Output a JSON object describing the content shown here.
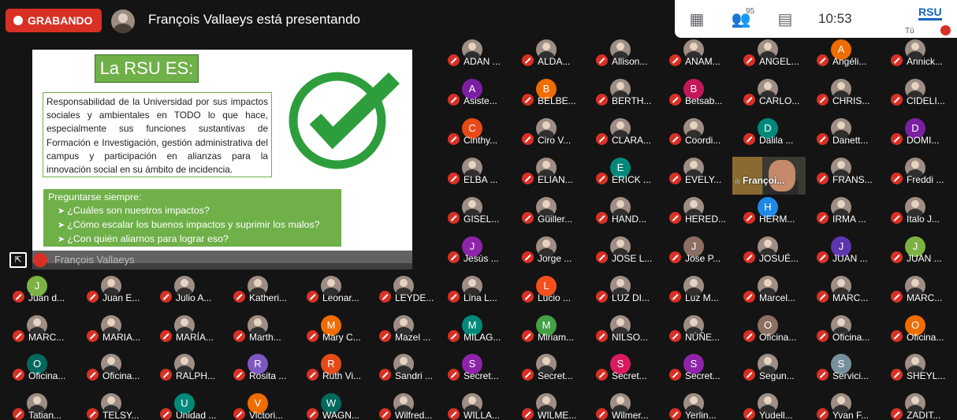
{
  "recording": {
    "label": "GRABANDO"
  },
  "presenter": {
    "text": "François Vallaeys está presentando",
    "name": "François Vallaeys"
  },
  "toolbar": {
    "participants_count": "95",
    "time": "10:53",
    "self_label": "Tú",
    "logo_text": "RSU"
  },
  "slide": {
    "title": "La RSU ES:",
    "body": "Responsabilidad de la Universidad por sus impactos sociales y ambientales en TODO lo que hace, especialmente sus funciones sustantivas de Formación e Investigación, gestión administrativa del campus y participación en alianzas para la innovación social en su ámbito de incidencia.",
    "q_title": "Preguntarse siempre:",
    "questions": [
      "¿Cuáles son nuestros impactos?",
      "¿Cómo escalar los buenos impactos y suprimir los malos?",
      "¿Con quién aliarnos para lograr eso?"
    ]
  },
  "active_video_label": "Françoi...",
  "colors": {
    "accent_red": "#d93025",
    "slide_green": "#6fb049"
  },
  "participants": [
    {
      "name": "ADAN ...",
      "av": "photo"
    },
    {
      "name": "ALDA...",
      "av": "photo"
    },
    {
      "name": "Allison...",
      "av": "photo"
    },
    {
      "name": "ANAM...",
      "av": "photo"
    },
    {
      "name": "ANGEL...",
      "av": "photo"
    },
    {
      "name": "Angéli...",
      "av": "A",
      "bg": "#ef6c00"
    },
    {
      "name": "Annick...",
      "av": "photo"
    },
    {
      "name": "Asiste...",
      "av": "A",
      "bg": "#7b1fa2"
    },
    {
      "name": "BELBE...",
      "av": "B",
      "bg": "#ef6c00"
    },
    {
      "name": "BERTH...",
      "av": "photo"
    },
    {
      "name": "Betsab...",
      "av": "B",
      "bg": "#c2185b"
    },
    {
      "name": "CARLO...",
      "av": "photo"
    },
    {
      "name": "CHRIS...",
      "av": "photo"
    },
    {
      "name": "CIDELI...",
      "av": "photo"
    },
    {
      "name": "Cinthy...",
      "av": "C",
      "bg": "#e64a19"
    },
    {
      "name": "Ciro V...",
      "av": "photo"
    },
    {
      "name": "CLARA...",
      "av": "photo"
    },
    {
      "name": "Coordi...",
      "av": "photo"
    },
    {
      "name": "Dalila ...",
      "av": "D",
      "bg": "#00897b"
    },
    {
      "name": "Danett...",
      "av": "photo"
    },
    {
      "name": "DOMI...",
      "av": "D",
      "bg": "#7b1fa2"
    },
    {
      "name": "ELBA ...",
      "av": "photo"
    },
    {
      "name": "ELIAN...",
      "av": "photo"
    },
    {
      "name": "ERICK ...",
      "av": "E",
      "bg": "#00897b"
    },
    {
      "name": "EVELY...",
      "av": "photo"
    },
    {
      "name": "FRANS...",
      "av": "photo"
    },
    {
      "name": "Freddi ...",
      "av": "photo"
    },
    {
      "name": "GISEL...",
      "av": "photo"
    },
    {
      "name": "Güiller...",
      "av": "photo"
    },
    {
      "name": "HAND...",
      "av": "photo"
    },
    {
      "name": "HERED...",
      "av": "photo"
    },
    {
      "name": "HERM...",
      "av": "H",
      "bg": "#1e88e5"
    },
    {
      "name": "IRMA ...",
      "av": "photo"
    },
    {
      "name": "Italo J...",
      "av": "photo"
    },
    {
      "name": "Jesús ...",
      "av": "J",
      "bg": "#8e24aa"
    },
    {
      "name": "Jorge ...",
      "av": "photo"
    },
    {
      "name": "JOSE L...",
      "av": "photo"
    },
    {
      "name": "Jose P...",
      "av": "J",
      "bg": "#8d6e63"
    },
    {
      "name": "JOSUÉ...",
      "av": "photo"
    },
    {
      "name": "JUAN ...",
      "av": "J",
      "bg": "#5e35b1"
    },
    {
      "name": "JUAN ...",
      "av": "J",
      "bg": "#7cb342"
    },
    {
      "name": "Juan d...",
      "av": "J",
      "bg": "#7cb342"
    },
    {
      "name": "Juan E...",
      "av": "photo"
    },
    {
      "name": "Julio A...",
      "av": "photo"
    },
    {
      "name": "Katheri...",
      "av": "photo"
    },
    {
      "name": "Leonar...",
      "av": "photo"
    },
    {
      "name": "LEYDE...",
      "av": "photo"
    },
    {
      "name": "Lina L...",
      "av": "photo"
    },
    {
      "name": "Lucio ...",
      "av": "L",
      "bg": "#f4511e"
    },
    {
      "name": "LUZ DI...",
      "av": "photo"
    },
    {
      "name": "Luz M...",
      "av": "photo"
    },
    {
      "name": "Marcel...",
      "av": "photo"
    },
    {
      "name": "MARC...",
      "av": "photo"
    },
    {
      "name": "MARC...",
      "av": "photo"
    },
    {
      "name": "MARC...",
      "av": "photo"
    },
    {
      "name": "MARIA...",
      "av": "photo"
    },
    {
      "name": "MARÍA...",
      "av": "photo"
    },
    {
      "name": "Marth...",
      "av": "photo"
    },
    {
      "name": "Mary C...",
      "av": "M",
      "bg": "#ef6c00"
    },
    {
      "name": "Mazel ...",
      "av": "photo"
    },
    {
      "name": "MILAG...",
      "av": "M",
      "bg": "#00897b"
    },
    {
      "name": "Miriam...",
      "av": "M",
      "bg": "#43a047"
    },
    {
      "name": "NILSO...",
      "av": "photo"
    },
    {
      "name": "NÚÑE...",
      "av": "photo"
    },
    {
      "name": "Oficina...",
      "av": "O",
      "bg": "#8d6e63"
    },
    {
      "name": "Oficina...",
      "av": "photo"
    },
    {
      "name": "Oficina...",
      "av": "O",
      "bg": "#ef6c00"
    },
    {
      "name": "Oficina...",
      "av": "O",
      "bg": "#00695c"
    },
    {
      "name": "Oficina...",
      "av": "photo"
    },
    {
      "name": "RALPH...",
      "av": "photo"
    },
    {
      "name": "Rosita ...",
      "av": "R",
      "bg": "#7e57c2"
    },
    {
      "name": "Ruth Vi...",
      "av": "R",
      "bg": "#e64a19"
    },
    {
      "name": "Sandri ...",
      "av": "photo"
    },
    {
      "name": "Secret...",
      "av": "S",
      "bg": "#8e24aa"
    },
    {
      "name": "Secret...",
      "av": "photo"
    },
    {
      "name": "Secret...",
      "av": "S",
      "bg": "#d81b60"
    },
    {
      "name": "Secret...",
      "av": "S",
      "bg": "#8e24aa"
    },
    {
      "name": "Segun...",
      "av": "photo"
    },
    {
      "name": "Servici...",
      "av": "S",
      "bg": "#78909c"
    },
    {
      "name": "SHEYL...",
      "av": "photo"
    },
    {
      "name": "Tatian...",
      "av": "photo"
    },
    {
      "name": "TELSY...",
      "av": "photo"
    },
    {
      "name": "Unidad ...",
      "av": "U",
      "bg": "#00897b"
    },
    {
      "name": "Victori...",
      "av": "V",
      "bg": "#ef6c00"
    },
    {
      "name": "WAGN...",
      "av": "W",
      "bg": "#00695c"
    },
    {
      "name": "Wilfred...",
      "av": "photo"
    },
    {
      "name": "WILLA...",
      "av": "photo"
    },
    {
      "name": "WILME...",
      "av": "photo"
    },
    {
      "name": "Wilmer...",
      "av": "photo"
    },
    {
      "name": "Yerlin...",
      "av": "photo"
    },
    {
      "name": "Yudell...",
      "av": "photo"
    },
    {
      "name": "Yvan F...",
      "av": "photo"
    },
    {
      "name": "ZADIT...",
      "av": "photo"
    }
  ]
}
